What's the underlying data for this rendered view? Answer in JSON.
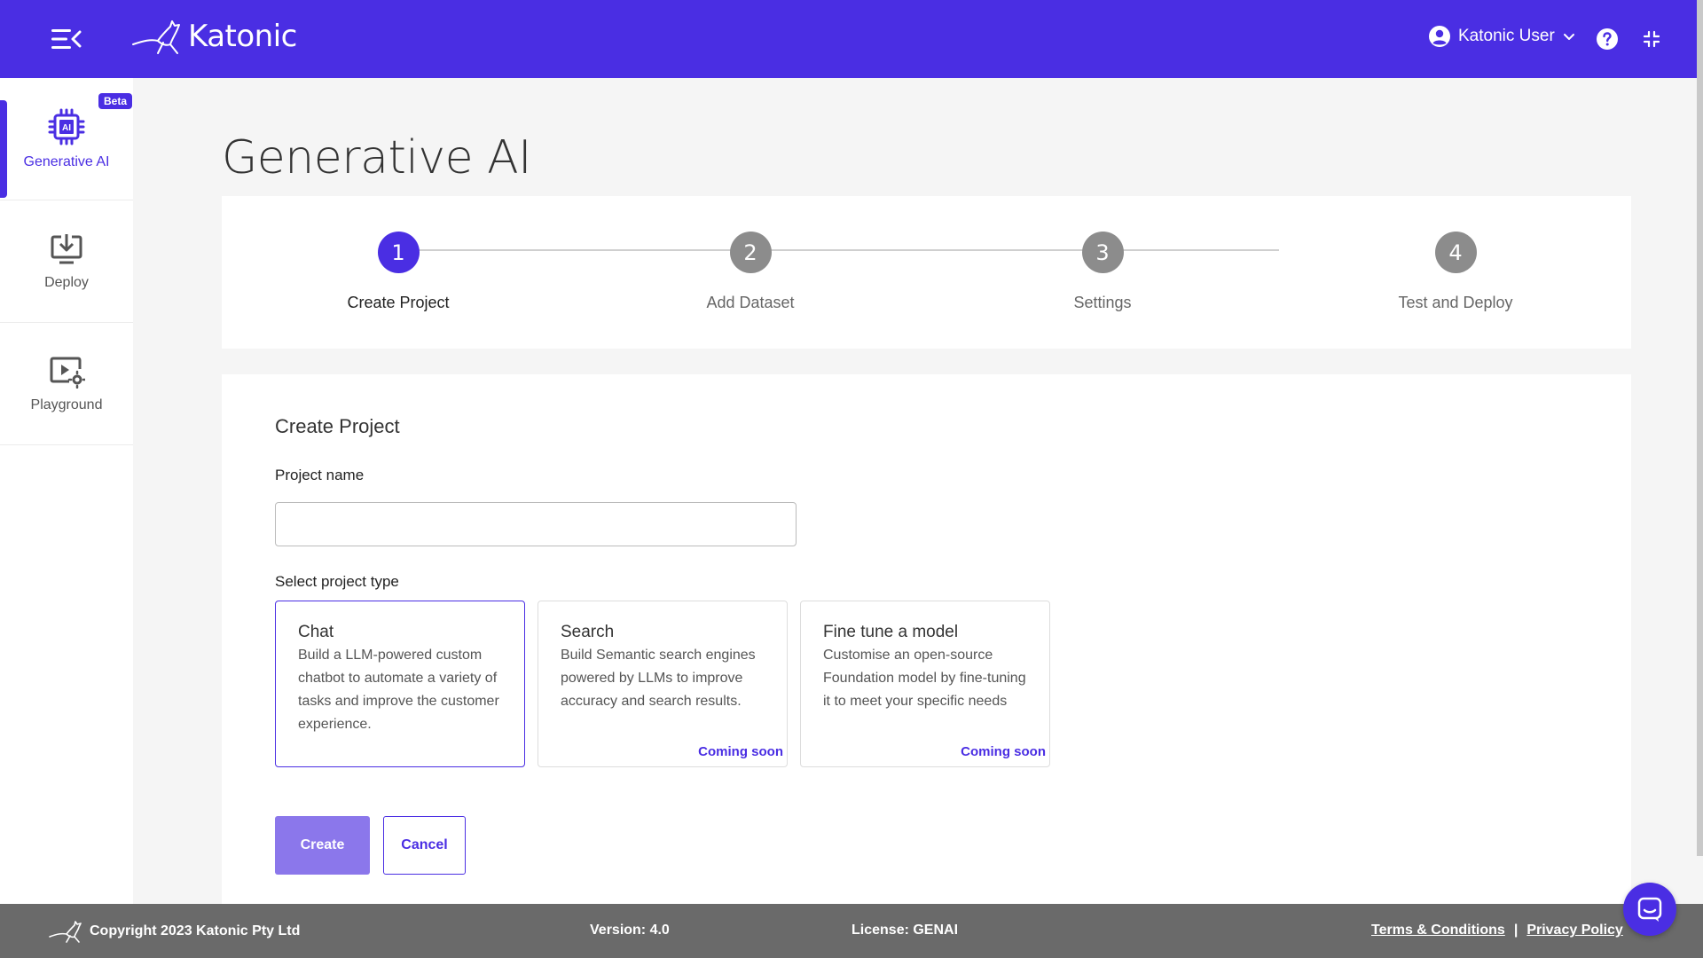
{
  "header": {
    "logo_text": "Katonic",
    "user_name": "Katonic User",
    "icons": [
      "menu-collapse-icon",
      "kangaroo-logo-icon",
      "user-avatar-icon",
      "chevron-down-icon",
      "help-icon",
      "fullscreen-exit-icon"
    ],
    "accent_color": "#4a2ee3"
  },
  "sidebar": {
    "items": [
      {
        "label": "Generative AI",
        "icon": "ai-chip-icon",
        "badge": "Beta",
        "active": true
      },
      {
        "label": "Deploy",
        "icon": "deploy-icon",
        "active": false
      },
      {
        "label": "Playground",
        "icon": "playground-icon",
        "active": false
      }
    ]
  },
  "main": {
    "title": "Generative AI",
    "steps": [
      {
        "number": "1",
        "label": "Create Project",
        "active": true
      },
      {
        "number": "2",
        "label": "Add Dataset",
        "active": false
      },
      {
        "number": "3",
        "label": "Settings",
        "active": false
      },
      {
        "number": "4",
        "label": "Test and Deploy",
        "active": false
      }
    ],
    "form": {
      "title": "Create Project",
      "name_label": "Project name",
      "name_value": "",
      "type_label": "Select project type",
      "types": [
        {
          "name": "Chat",
          "description": "Build a LLM-powered custom chatbot to automate a variety of tasks and improve the customer experience.",
          "badge": "",
          "selected": true
        },
        {
          "name": "Search",
          "description": "Build Semantic search engines powered by LLMs to improve accuracy and search results.",
          "badge": "Coming soon",
          "selected": false
        },
        {
          "name": "Fine tune a model",
          "description": "Customise an open-source Foundation model by fine-tuning it to meet your specific needs",
          "badge": "Coming soon",
          "selected": false
        }
      ],
      "create_label": "Create",
      "cancel_label": "Cancel"
    }
  },
  "footer": {
    "copyright": "Copyright 2023 Katonic Pty Ltd",
    "version": "Version: 4.0",
    "license": "License: GENAI",
    "terms": "Terms & Conditions",
    "separator": "|",
    "privacy": "Privacy Policy"
  }
}
